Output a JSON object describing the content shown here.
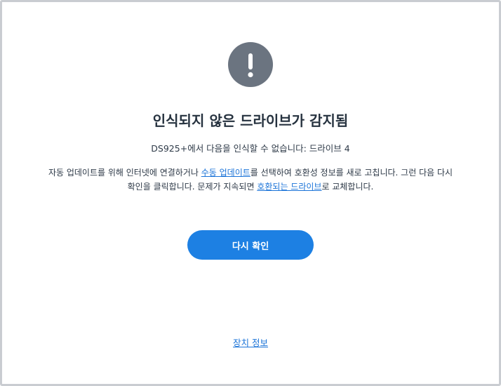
{
  "dialog": {
    "icon": "exclamation-icon",
    "icon_color": "#6b7480",
    "title": "인식되지 않은 드라이브가 감지됨",
    "subtitle": "DS925+에서 다음을 인식할 수 없습니다: 드라이브 4",
    "description": {
      "line1_pre": "자동 업데이트를 위해 인터넷에 연결하거나 ",
      "manual_update_link": "수동 업데이트",
      "line1_post": "를 선택하여 호환성 정보를 새로 고칩니다. 그런 다음 다시",
      "line2_pre": "확인을 클릭합니다. 문제가 지속되면 ",
      "compatible_drive_link": "호환되는 드라이브",
      "line2_post": "로 교체합니다."
    },
    "recheck_button": "다시 확인",
    "device_info_link": "장치 정보",
    "accent_color": "#1d80e3",
    "link_color": "#1a73d8"
  }
}
